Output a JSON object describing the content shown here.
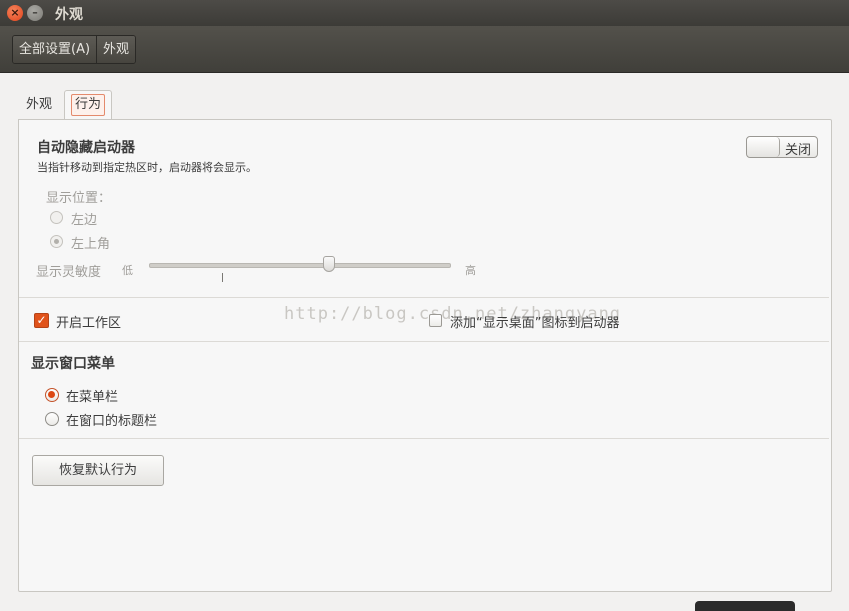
{
  "window": {
    "title": "外观"
  },
  "breadcrumb": {
    "all_settings": "全部设置(A)",
    "current": "外观"
  },
  "tabs": [
    {
      "label": "外观",
      "active": false
    },
    {
      "label": "行为",
      "active": true
    }
  ],
  "autohide": {
    "title": "自动隐藏启动器",
    "description": "当指针移动到指定热区时，启动器将会显示。",
    "switch_label": "关闭",
    "switch_on": false,
    "position_label": "显示位置：",
    "position_options": [
      "左边",
      "左上角"
    ],
    "position_selected": "左上角",
    "sensitivity_label": "显示灵敏度",
    "sensitivity_low": "低",
    "sensitivity_high": "高",
    "sensitivity_value_fraction": 0.6
  },
  "workspaces": {
    "label": "开启工作区",
    "checked": true
  },
  "show_desktop": {
    "label": "添加“显示桌面”图标到启动器",
    "checked": false
  },
  "window_menu": {
    "title": "显示窗口菜单",
    "options": [
      "在菜单栏",
      "在窗口的标题栏"
    ],
    "selected": "在菜单栏"
  },
  "restore_button": "恢复默认行为",
  "watermark": "http://blog.csdn.net/zhangyang",
  "colors": {
    "accent": "#dd4814",
    "titlebar": "#3c3b37"
  }
}
